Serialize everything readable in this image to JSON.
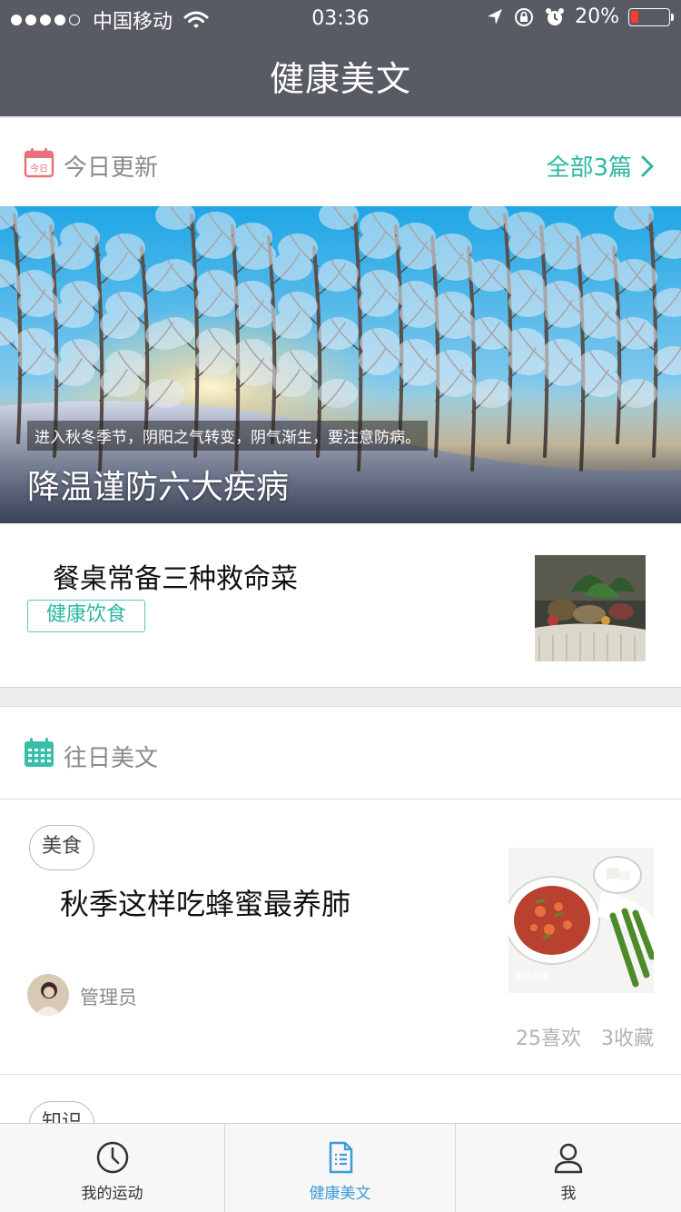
{
  "status_bar": {
    "carrier": "中国移动",
    "time": "03:36",
    "battery": "20%",
    "battery_level": 0.2,
    "signal_bars": 4
  },
  "nav": {
    "title": "健康美文"
  },
  "today": {
    "section_title": "今日更新",
    "icon_text": "今日",
    "all_link": "全部3篇",
    "featured": {
      "subtitle": "进入秋冬季节，阴阳之气转变，阴气渐生，要注意防病。",
      "title": "降温谨防六大疾病"
    },
    "item": {
      "title": "餐桌常备三种救命菜",
      "tag": "健康饮食"
    }
  },
  "past": {
    "section_title": "往日美文",
    "articles": [
      {
        "tag": "美食",
        "title": "秋季这样吃蜂蜜最养肺",
        "author": "管理员",
        "likes": "25喜欢",
        "favorites": "3收藏",
        "thumb_caption": "宝络厨房"
      },
      {
        "tag": "知识"
      }
    ]
  },
  "tabs": [
    {
      "label": "我的运动",
      "icon": "clock-icon",
      "active": false
    },
    {
      "label": "健康美文",
      "icon": "document-icon",
      "active": true
    },
    {
      "label": "我",
      "icon": "person-icon",
      "active": false
    }
  ],
  "colors": {
    "nav_bg": "#595b64",
    "accent_green": "#2cb7a3",
    "tab_active": "#3d9bd8",
    "calendar_red": "#e8727a"
  }
}
